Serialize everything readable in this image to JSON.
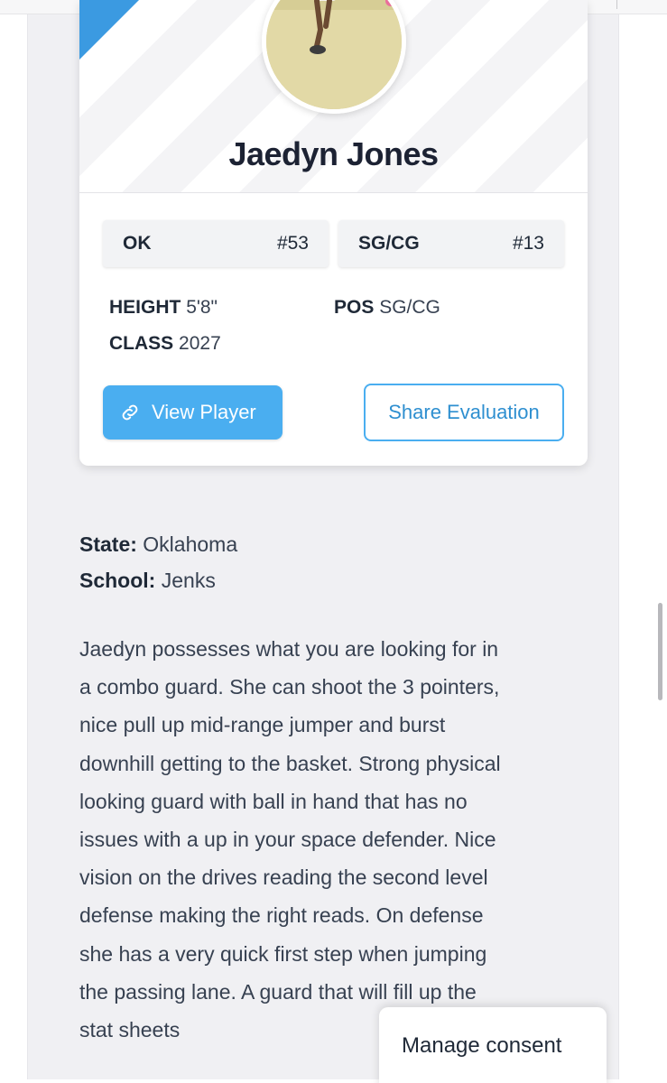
{
  "player": {
    "name": "Jaedyn Jones",
    "avatar_alt": "player photo"
  },
  "badges": [
    {
      "left": "OK",
      "right": "#53"
    },
    {
      "left": "SG/CG",
      "right": "#13"
    }
  ],
  "stats": {
    "height_label": "HEIGHT",
    "height_value": "5'8\"",
    "pos_label": "POS",
    "pos_value": "SG/CG",
    "class_label": "CLASS",
    "class_value": "2027"
  },
  "buttons": {
    "view_player": "View Player",
    "share_evaluation": "Share Evaluation"
  },
  "details": {
    "state_label": "State:",
    "state_value": "Oklahoma",
    "school_label": "School:",
    "school_value": "Jenks"
  },
  "evaluation_lines": [
    "Jaedyn possesses what you are looking for in",
    "a combo guard. She can shoot the 3 pointers,",
    "nice pull up mid-range jumper and burst",
    "downhill getting to the basket. Strong physical",
    "looking guard with ball in hand that has no",
    "issues with a up in your space defender. Nice",
    "vision on the drives reading the second level",
    "defense making the right reads. On defense",
    "she has a very quick first step when jumping",
    "the passing lane. A guard that will fill up the",
    "stat sheets"
  ],
  "consent": {
    "label": "Manage consent"
  },
  "colors": {
    "accent": "#4aaef0",
    "ribbon": "#3b9ae1",
    "name": "#1c2233"
  }
}
